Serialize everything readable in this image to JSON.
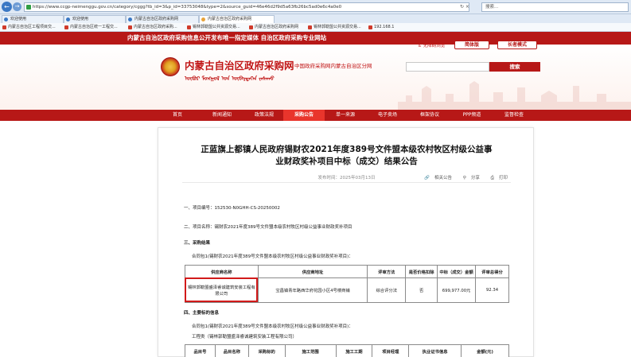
{
  "browser": {
    "url": "https://www.ccgp-neimenggu.gov.cn/category/cggg?tb_id=3&p_id=33753048&type=2&source_guid=46e46d2f9d5a63fb26bc5ad0e6c4a0e0",
    "search_placeholder": "搜索...",
    "tabs": [
      {
        "label": "欢迎使用"
      },
      {
        "label": "欢迎使用"
      },
      {
        "label": "内蒙古自治区政府采购网"
      },
      {
        "label": "内蒙古自治区政府采购网"
      }
    ],
    "favorites": [
      {
        "label": "内蒙古自治区工程项目交..."
      },
      {
        "label": "内蒙古自治区统一工程交..."
      },
      {
        "label": "内蒙古自治区政府采购..."
      },
      {
        "label": "锡林郭勒盟公共资源交易..."
      },
      {
        "label": "内蒙古自治区政府采购网"
      },
      {
        "label": "锡林郭勒盟公共资源交易..."
      },
      {
        "label": "192.168.1"
      }
    ]
  },
  "site": {
    "slogan": "内蒙古自治区政府采购信息公开发布唯一指定媒体  自治区政府采购专业网站",
    "accessibility_link": "无障碍浏览",
    "simplified_button": "简体版",
    "elder_button": "长者模式",
    "title": "内蒙古自治区政府采购网",
    "subtitle": "中国政府采购网内蒙古自治区分网",
    "mongol_text": "ᠦᠪᠦᠷ ᠮᠣᠩᠭᠣᠯ ᠤᠨ ᠥᠪᠡᠷᠲᠡᠭᠡᠨ ᠵᠠᠰᠠᠬᠤ",
    "search_button": "搜索"
  },
  "nav": {
    "items": [
      {
        "label": "首页"
      },
      {
        "label": "新闻通知"
      },
      {
        "label": "政策法规"
      },
      {
        "label": "采购公告"
      },
      {
        "label": "单一来源"
      },
      {
        "label": "电子卖场"
      },
      {
        "label": "框架协议"
      },
      {
        "label": "PPP频道"
      },
      {
        "label": "监督检查"
      }
    ]
  },
  "article": {
    "title_line1": "正蓝旗上都镇人民政府锡财农2021年度389号文件盟本级农村牧区村级公益事",
    "title_line2": "业财政奖补项目中标（成交）结果公告",
    "date": "发布时间：2025年03月13日",
    "related_link": "相关公告",
    "print_link": "打印",
    "share_link": "分享",
    "sec1": "一、项目编号：152530-N0GHH-CS-20250002",
    "sec2": "二、项目名称：锡财农2021年度389号文件盟本级农村牧区村级公益事业财政奖补项目",
    "sec3": "三、采购结果",
    "sec3_sub": "合同包1(锡财农2021年度389号文件盟本级农村牧区村级公益事业财政奖补项目)：",
    "result_table": {
      "headers": [
        "供应商名称",
        "供应商地址",
        "评审方法",
        "是否价格扣除",
        "中标（成交）金额",
        "评审总得分"
      ],
      "rows": [
        {
          "name": "锡林郭勒盟盛泽睿诚建筑安装工程有限公司",
          "address": "宝昌镇青年路西华府花园小区4号楼商铺",
          "method": "综合评分法",
          "price_deduct": "否",
          "amount": "699,977.00元",
          "score": "92.34"
        }
      ]
    },
    "sec4": "四、主要标的信息",
    "sec4_sub": "合同包1(锡财农2021年度389号文件盟本级农村牧区村级公益事业财政奖补项目)：",
    "sec4_eng": "工程类（锡林郭勒盟盛泽睿诚建筑安装工程有限公司）",
    "target_table": {
      "headers": [
        "品目号",
        "品目名称",
        "采购标的",
        "施工范围",
        "施工工期",
        "项目经理",
        "执业证书信息",
        "金额(元)"
      ]
    }
  }
}
